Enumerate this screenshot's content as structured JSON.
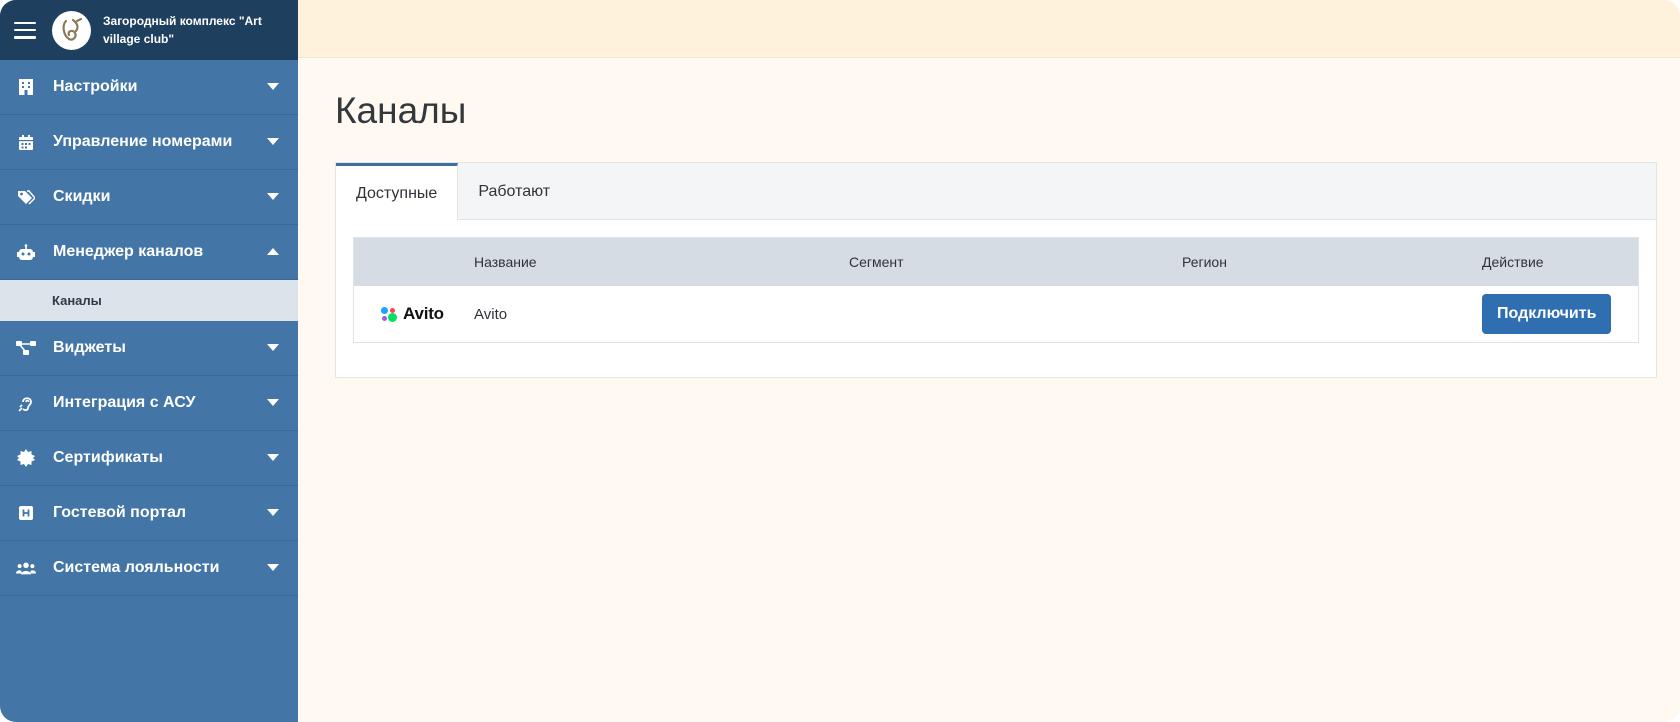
{
  "brand": {
    "title": "Загородный комплекс \"Art village club\""
  },
  "sidebar": {
    "items": [
      {
        "label": "Настройки",
        "icon": "building-icon",
        "expanded": false
      },
      {
        "label": "Управление номерами",
        "icon": "calendar-icon",
        "expanded": false
      },
      {
        "label": "Скидки",
        "icon": "tags-icon",
        "expanded": false
      },
      {
        "label": "Менеджер каналов",
        "icon": "robot-icon",
        "expanded": true
      },
      {
        "label": "Виджеты",
        "icon": "network-icon",
        "expanded": false
      },
      {
        "label": "Интеграция с АСУ",
        "icon": "ear-icon",
        "expanded": false
      },
      {
        "label": "Сертификаты",
        "icon": "certificate-icon",
        "expanded": false
      },
      {
        "label": "Гостевой портал",
        "icon": "h-square-icon",
        "expanded": false
      },
      {
        "label": "Система лояльности",
        "icon": "users-icon",
        "expanded": false
      }
    ],
    "subitem": {
      "label": "Каналы"
    }
  },
  "main": {
    "title": "Каналы",
    "tabs": [
      {
        "label": "Доступные",
        "active": true
      },
      {
        "label": "Работают",
        "active": false
      }
    ],
    "table": {
      "headers": {
        "name": "Название",
        "segment": "Сегмент",
        "region": "Регион",
        "action": "Действие"
      },
      "rows": [
        {
          "logo": "Avito",
          "name": "Avito",
          "segment": "",
          "region": "",
          "action_label": "Подключить"
        }
      ]
    }
  },
  "colors": {
    "sidebar": "#4375a6",
    "brand_bar": "#1f3f5f",
    "topbar": "#fff2dd",
    "primary_button": "#2f6fb1"
  }
}
